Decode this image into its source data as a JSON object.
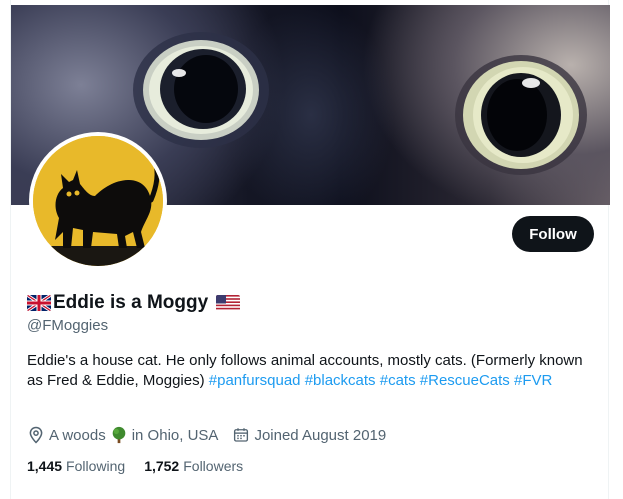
{
  "profile": {
    "display_name": "Eddie is a Moggy",
    "handle": "@FMoggies",
    "follow_label": "Follow",
    "bio_text": "Eddie's a house cat. He only follows animal accounts, mostly cats. (Formerly known as Fred & Eddie, Moggies) ",
    "hashtags": [
      "#panfursquad",
      "#blackcats",
      "#cats",
      "#RescueCats",
      "#FVR"
    ],
    "location_prefix": "A woods",
    "location_suffix": "in Ohio, USA",
    "joined": "Joined August 2019",
    "following_count": "1,445",
    "following_label": "Following",
    "followers_count": "1,752",
    "followers_label": "Followers"
  },
  "icons": {
    "name_left": "uk-flag-icon",
    "name_right": "us-flag-icon",
    "location": "location-pin-icon",
    "tree": "tree-emoji-icon",
    "calendar": "calendar-icon"
  },
  "colors": {
    "link": "#1d9bf0",
    "muted": "#536471",
    "text": "#0f1419",
    "follow_bg": "#0f1419",
    "avatar_bg": "#e8b92a"
  }
}
